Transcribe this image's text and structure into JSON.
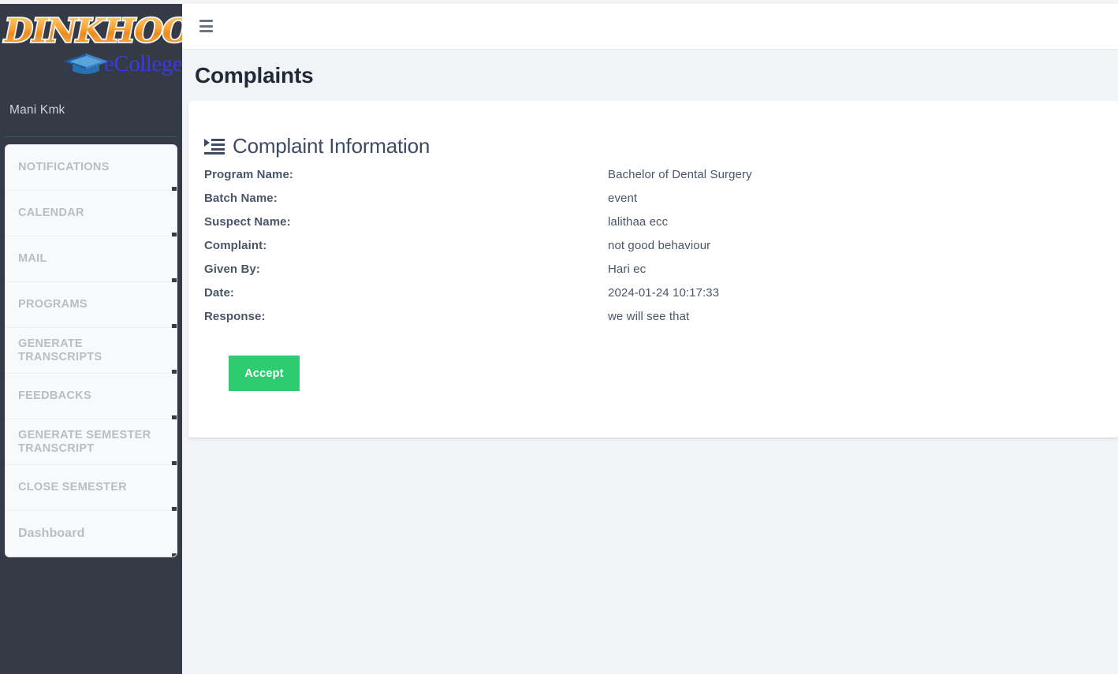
{
  "brand": {
    "logo_primary": "DINKHOO!",
    "logo_secondary": "eCollege",
    "logo_colors": {
      "primary": "#f0922b",
      "secondary": "#3a3ae0"
    }
  },
  "sidebar": {
    "user_name": "Mani Kmk",
    "background_color": "#343a46",
    "items": [
      {
        "label": "NOTIFICATIONS"
      },
      {
        "label": "CALENDAR"
      },
      {
        "label": "MAIL"
      },
      {
        "label": "PROGRAMS"
      },
      {
        "label": "GENERATE TRANSCRIPTS"
      },
      {
        "label": "FEEDBACKS"
      },
      {
        "label": "GENERATE SEMESTER TRANSCRIPT"
      },
      {
        "label": "CLOSE SEMESTER"
      },
      {
        "label": "Dashboard"
      }
    ]
  },
  "topbar": {
    "menu_icon": "hamburger-icon"
  },
  "page": {
    "title": "Complaints"
  },
  "card": {
    "heading_icon": "indent-list-icon",
    "heading": "Complaint Information",
    "details": [
      {
        "label": "Program Name:",
        "value": "Bachelor of Dental Surgery"
      },
      {
        "label": "Batch Name:",
        "value": "event"
      },
      {
        "label": "Suspect Name:",
        "value": "lalithaa ecc"
      },
      {
        "label": "Complaint:",
        "value": "not good behaviour"
      },
      {
        "label": "Given By:",
        "value": "Hari ec"
      },
      {
        "label": "Date:",
        "value": "2024-01-24 10:17:33"
      },
      {
        "label": "Response:",
        "value": "we will see that"
      }
    ],
    "accept_label": "Accept",
    "accept_color": "#2ecc71"
  }
}
